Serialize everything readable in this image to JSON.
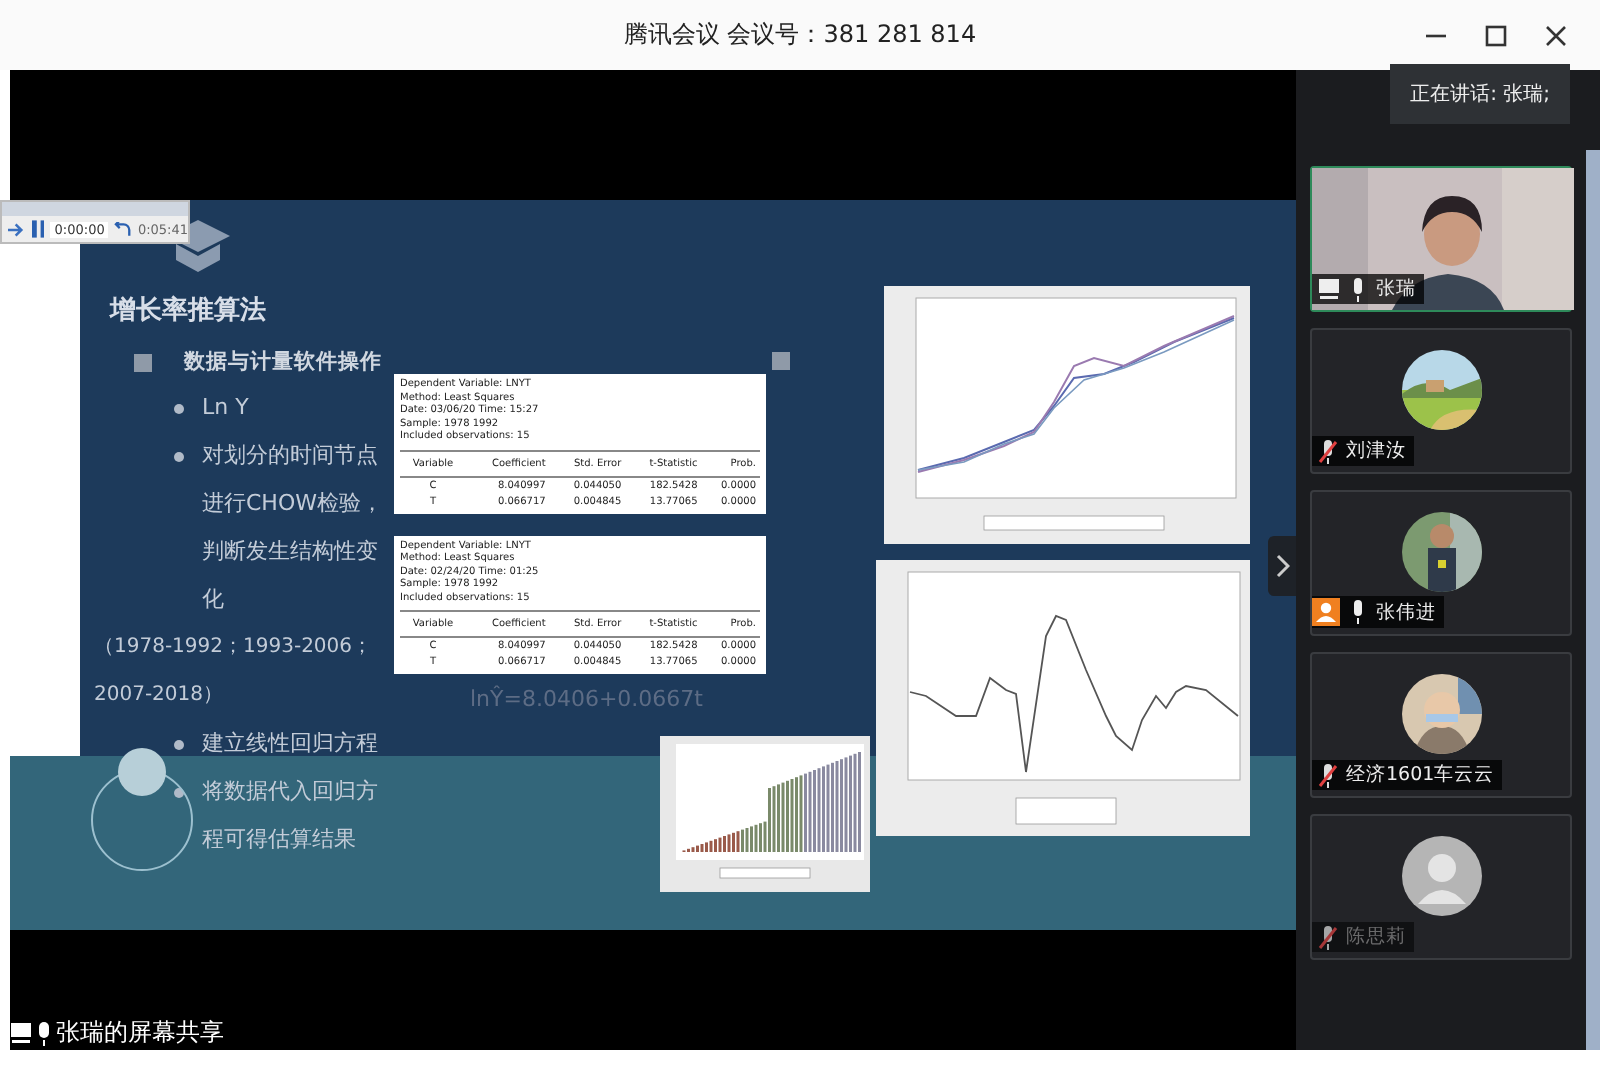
{
  "window": {
    "title": "腾讯会议 会议号：381 281 814"
  },
  "speaking_toast": "正在讲话: 张瑞;",
  "player": {
    "elapsed": "0:00:00",
    "remaining": "0:05:41",
    "playing": true
  },
  "slide": {
    "title": "增长率推算法",
    "section": "数据与计量软件操作",
    "bullets": [
      {
        "kind": "bullet",
        "text": "Ln Y"
      },
      {
        "kind": "bullet",
        "text": "对划分的时间节点进行CHOW检验，判断发生结构性变化"
      },
      {
        "kind": "note",
        "text": "（1978-1992；1993-2006；2007-2018）"
      },
      {
        "kind": "bullet",
        "text": "建立线性回归方程"
      },
      {
        "kind": "bullet",
        "text": "将数据代入回归方程可得估算结果"
      }
    ],
    "regressions": [
      {
        "info": [
          "Dependent Variable: LNYT",
          "Method: Least Squares",
          "Date: 03/06/20   Time: 15:27",
          "Sample: 1978 1992",
          "Included observations: 15"
        ],
        "columns": [
          "Variable",
          "Coefficient",
          "Std. Error",
          "t-Statistic",
          "Prob."
        ],
        "rows": [
          [
            "C",
            "8.040997",
            "0.044050",
            "182.5428",
            "0.0000"
          ],
          [
            "T",
            "0.066717",
            "0.004845",
            "13.77065",
            "0.0000"
          ]
        ]
      },
      {
        "info": [
          "Dependent Variable: LNYT",
          "Method: Least Squares",
          "Date: 02/24/20   Time: 01:25",
          "Sample: 1978 1992",
          "Included observations: 15"
        ],
        "columns": [
          "Variable",
          "Coefficient",
          "Std. Error",
          "t-Statistic",
          "Prob."
        ],
        "rows": [
          [
            "C",
            "8.040997",
            "0.044050",
            "182.5428",
            "0.0000"
          ],
          [
            "T",
            "0.066717",
            "0.004845",
            "13.77065",
            "0.0000"
          ]
        ]
      }
    ],
    "equation": "lnŶ=8.0406+0.0667t"
  },
  "participants": [
    {
      "name": "张瑞",
      "kind": "video",
      "muted": false,
      "sharing": true,
      "host": false,
      "speaking": true,
      "dimmed": false
    },
    {
      "name": "刘津汝",
      "muted": true,
      "sharing": false,
      "host": false,
      "speaking": false,
      "dimmed": false
    },
    {
      "name": "张伟进",
      "muted": false,
      "sharing": false,
      "host": true,
      "speaking": false,
      "dimmed": false
    },
    {
      "name": "经济1601车云云",
      "muted": true,
      "sharing": false,
      "host": false,
      "speaking": false,
      "dimmed": false
    },
    {
      "name": "陈思莉",
      "kind": "default",
      "muted": true,
      "sharing": false,
      "host": false,
      "speaking": false,
      "dimmed": true
    }
  ],
  "share_label": "张瑞的屏幕共享"
}
